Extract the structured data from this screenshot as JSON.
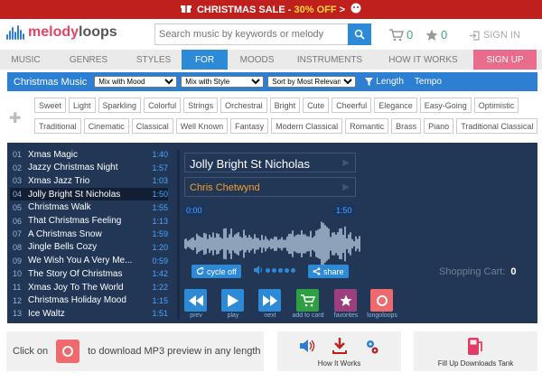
{
  "banner": {
    "prefix": "CHRISTMAS SALE - ",
    "discount": "30% OFF",
    "suffix": " >"
  },
  "header": {
    "logo": {
      "part1": "melody",
      "part2": "loops"
    },
    "search_placeholder": "Search music by keywords or melody",
    "cart_count": "0",
    "favorites_count": "0",
    "signin_label": "SIGN IN"
  },
  "nav": {
    "items": [
      {
        "label": "MUSIC",
        "width": 57
      },
      {
        "label": "GENRES",
        "width": 82
      },
      {
        "label": "STYLES",
        "width": 62
      },
      {
        "label": "FOR",
        "width": 51
      },
      {
        "label": "MOODS",
        "width": 65
      },
      {
        "label": "INSTRUMENTS",
        "width": 96
      },
      {
        "label": "HOW IT WORKS",
        "width": 111
      },
      {
        "label": "SIGN UP",
        "width": 70
      }
    ]
  },
  "filters": {
    "category": "Christmas Music",
    "mood": "Mix with Mood",
    "style": "Mix with Style",
    "sort": "Sort by Most Relevant",
    "length": "Length",
    "tempo": "Tempo"
  },
  "tags": {
    "row1": [
      "Sweet",
      "Light",
      "Sparkling",
      "Colorful",
      "Strings",
      "Orchestral",
      "Bright",
      "Cute",
      "Cheerful",
      "Elegance",
      "Easy-Going",
      "Optimistic"
    ],
    "row2": [
      "Traditional",
      "Cinematic",
      "Classical",
      "Well Known",
      "Fantasy",
      "Modern Classical",
      "Romantic",
      "Brass",
      "Piano",
      "Traditional Classical"
    ]
  },
  "tracks": [
    {
      "num": "01",
      "name": "Xmas Magic",
      "dur": "1:40"
    },
    {
      "num": "02",
      "name": "Jazzy Christmas Night",
      "dur": "1:57"
    },
    {
      "num": "03",
      "name": "Xmas Jazz Trio",
      "dur": "1:03"
    },
    {
      "num": "04",
      "name": "Jolly Bright St Nicholas",
      "dur": "1:50"
    },
    {
      "num": "05",
      "name": "Christmas Walk",
      "dur": "1:55"
    },
    {
      "num": "06",
      "name": "That Christmas Feeling",
      "dur": "1:13"
    },
    {
      "num": "07",
      "name": "A Christmas Snow",
      "dur": "1:59"
    },
    {
      "num": "08",
      "name": "Jingle Bells Cozy",
      "dur": "1:20"
    },
    {
      "num": "09",
      "name": "We Wish You A Very Me...",
      "dur": "0:59"
    },
    {
      "num": "10",
      "name": "The Story Of Christmas",
      "dur": "1:42"
    },
    {
      "num": "11",
      "name": "Xmas Joy To The World",
      "dur": "1:22"
    },
    {
      "num": "12",
      "name": "Christmas Holiday Mood",
      "dur": "1:15"
    },
    {
      "num": "13",
      "name": "Ice Waltz",
      "dur": "1:51"
    }
  ],
  "selected_track": {
    "title": "Jolly Bright St Nicholas",
    "artist": "Chris Chetwynd",
    "time_start": "0:00",
    "time_end": "1:50"
  },
  "controls": {
    "cycle_label": "cycle off",
    "share_label": "share",
    "prev": "prev",
    "play": "play",
    "next": "next",
    "add": "add to card",
    "fav": "favorites",
    "loops": "longoloops",
    "shopping_cart_label": "Shopping Cart:",
    "shopping_cart_count": "0",
    "colors": {
      "blue": "#2d8ad7",
      "green": "#2ea043",
      "purple": "#9c3f7e",
      "coral": "#f0696d"
    }
  },
  "info": {
    "click_on": "Click on",
    "download_text": "to download MP3 preview in any length",
    "how_it_works": "How It Works",
    "fill_up": "Fill Up Downloads Tank"
  }
}
